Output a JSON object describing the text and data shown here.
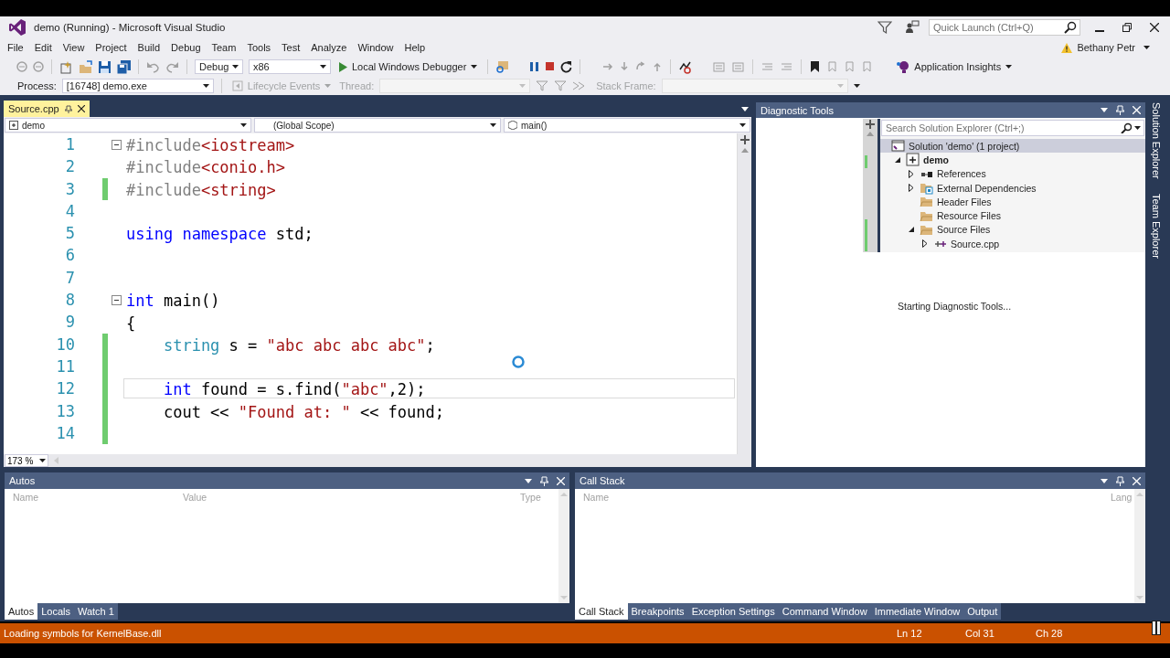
{
  "window": {
    "title": "demo (Running) - Microsoft Visual Studio",
    "quick_launch": {
      "placeholder": "Quick Launch (Ctrl+Q)"
    },
    "user": "Bethany Petr"
  },
  "menu": [
    "File",
    "Edit",
    "View",
    "Project",
    "Build",
    "Debug",
    "Team",
    "Tools",
    "Test",
    "Analyze",
    "Window",
    "Help"
  ],
  "toolbar": {
    "configuration": "Debug",
    "platform": "x86",
    "start": "Local Windows Debugger",
    "insights": "Application Insights"
  },
  "debug_location": {
    "process_label": "Process:",
    "process": "[16748] demo.exe",
    "lifecycle": {
      "label": "Lifecycle Events",
      "disabled": true
    },
    "thread": {
      "label": "Thread:",
      "disabled": true
    },
    "stack_frame": {
      "label": "Stack Frame:",
      "disabled": true
    }
  },
  "editor": {
    "tab": {
      "label": "Source.cpp",
      "selected": true
    },
    "nav": [
      "demo",
      "(Global Scope)",
      "main()"
    ],
    "zoom": "173 %",
    "lines": [
      {
        "number": "1",
        "tokens": [
          {
            "kind": "pp",
            "text": "#include"
          },
          {
            "kind": "str",
            "text": "<iostream>"
          }
        ],
        "fold": true,
        "changed": false,
        "current": false
      },
      {
        "number": "2",
        "tokens": [
          {
            "kind": "pp",
            "text": "#include"
          },
          {
            "kind": "str",
            "text": "<conio.h>"
          }
        ],
        "fold": false,
        "changed": false,
        "current": false
      },
      {
        "number": "3",
        "tokens": [
          {
            "kind": "pp",
            "text": "#include"
          },
          {
            "kind": "str",
            "text": "<string>"
          }
        ],
        "fold": false,
        "changed": true,
        "current": false
      },
      {
        "number": "4",
        "fold": false,
        "changed": false,
        "current": false
      },
      {
        "number": "5",
        "tokens": [
          {
            "kind": "kw",
            "text": "using"
          },
          {
            "kind": "kw",
            "text": " namespace"
          },
          {
            "kind": "plain",
            "text": " std;"
          }
        ],
        "fold": false,
        "changed": false,
        "current": false
      },
      {
        "number": "6",
        "fold": false,
        "changed": false,
        "current": false
      },
      {
        "number": "7",
        "fold": false,
        "changed": false,
        "current": false
      },
      {
        "number": "8",
        "tokens": [
          {
            "kind": "kw",
            "text": "int"
          },
          {
            "kind": "plain",
            "text": " main()"
          }
        ],
        "fold": true,
        "changed": false,
        "current": false
      },
      {
        "number": "9",
        "tokens": [
          {
            "kind": "plain",
            "text": "{"
          }
        ],
        "fold": false,
        "changed": false,
        "current": false
      },
      {
        "number": "10",
        "tokens": [
          {
            "kind": "type",
            "text": "    string"
          },
          {
            "kind": "plain",
            "text": " s = "
          },
          {
            "kind": "str",
            "text": "\"abc abc abc abc\""
          },
          {
            "kind": "plain",
            "text": ";"
          }
        ],
        "fold": false,
        "changed": true,
        "current": false
      },
      {
        "number": "11",
        "fold": false,
        "changed": true,
        "current": false
      },
      {
        "number": "12",
        "tokens": [
          {
            "kind": "kw",
            "text": "    int"
          },
          {
            "kind": "plain",
            "text": " found = s.find("
          },
          {
            "kind": "str",
            "text": "\"abc\""
          },
          {
            "kind": "plain",
            "text": ",2);"
          }
        ],
        "fold": false,
        "changed": true,
        "current": true
      },
      {
        "number": "13",
        "tokens": [
          {
            "kind": "plain",
            "text": "    cout << "
          },
          {
            "kind": "str",
            "text": "\"Found at: \""
          },
          {
            "kind": "plain",
            "text": " << found;"
          }
        ],
        "fold": false,
        "changed": true,
        "current": false
      },
      {
        "number": "14",
        "fold": false,
        "changed": true,
        "current": false
      }
    ]
  },
  "diagnostics": {
    "title": "Diagnostic Tools",
    "status": "Starting Diagnostic Tools..."
  },
  "solution_explorer": {
    "search": {
      "placeholder": "Search Solution Explorer (Ctrl+;)"
    },
    "tree": [
      {
        "label": "Solution 'demo' (1 project)",
        "kind": "solution",
        "expandable": false,
        "selected": true,
        "children": [
          {
            "label": "demo",
            "kind": "project",
            "expandable": true,
            "expanded": true,
            "selected": false,
            "children": [
              {
                "label": "References",
                "kind": "references",
                "expandable": true,
                "expanded": false,
                "selected": false
              },
              {
                "label": "External Dependencies",
                "kind": "dependencies",
                "expandable": true,
                "expanded": false,
                "selected": false
              },
              {
                "label": "Header Files",
                "kind": "folder",
                "expandable": false,
                "selected": false
              },
              {
                "label": "Resource Files",
                "kind": "folder",
                "expandable": false,
                "selected": false
              },
              {
                "label": "Source Files",
                "kind": "folder",
                "expandable": true,
                "expanded": true,
                "selected": false,
                "children": [
                  {
                    "label": "Source.cpp",
                    "kind": "cpp",
                    "expandable": true,
                    "expanded": false,
                    "selected": false
                  }
                ]
              }
            ]
          }
        ]
      }
    ]
  },
  "side_tabs": [
    "Solution Explorer",
    "Team Explorer"
  ],
  "autos": {
    "title": "Autos",
    "columns": [
      "Name",
      "Value",
      "Type"
    ],
    "tabs": [
      {
        "label": "Autos",
        "selected": true
      },
      {
        "label": "Locals",
        "selected": false
      },
      {
        "label": "Watch 1",
        "selected": false
      }
    ]
  },
  "call_stack": {
    "title": "Call Stack",
    "columns": [
      "Name",
      "Lang"
    ],
    "tabs": [
      {
        "label": "Call Stack",
        "selected": true
      },
      {
        "label": "Breakpoints",
        "selected": false
      },
      {
        "label": "Exception Settings",
        "selected": false
      },
      {
        "label": "Command Window",
        "selected": false
      },
      {
        "label": "Immediate Window",
        "selected": false
      },
      {
        "label": "Output",
        "selected": false
      }
    ]
  },
  "status_bar": {
    "message": "Loading symbols for KernelBase.dll",
    "ln": "Ln 12",
    "col": "Col 31",
    "ch": "Ch 28"
  }
}
